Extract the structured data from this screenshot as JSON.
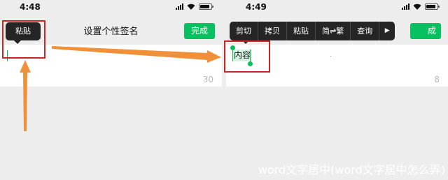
{
  "left_screen": {
    "status": {
      "time": "4:48"
    },
    "nav": {
      "title": "设置个性签名",
      "done": "完成"
    },
    "tooltip": {
      "paste": "粘贴"
    },
    "counter": "30"
  },
  "right_screen": {
    "status": {
      "time": "4:49"
    },
    "nav": {
      "done_partial": "成"
    },
    "menu": {
      "items": [
        "剪切",
        "拷贝",
        "粘贴",
        "简⇌繁",
        "查询"
      ]
    },
    "selected_text": "内容",
    "counter": "8"
  },
  "watermark": "word文字居中(word文字居中怎么弄)",
  "colors": {
    "accent_green": "#07c160",
    "annotation_red": "#c62828",
    "arrow_orange": "#f0913a",
    "menu_bg": "#252525"
  },
  "icons": [
    "signal-icon",
    "wifi-icon",
    "battery-icon",
    "play-more-icon"
  ]
}
